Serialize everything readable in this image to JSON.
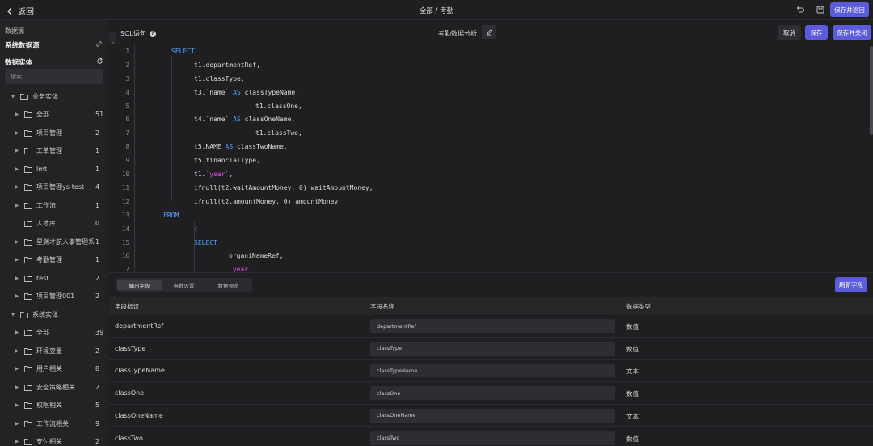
{
  "topbar": {
    "back_label": "返回",
    "title": "全部 / 考勤",
    "save_return_label": "保存并返回"
  },
  "sidebar": {
    "datasource_label": "数据源",
    "datasource_name": "系统数据源",
    "entity_title": "数据实体",
    "search_placeholder": "搜索",
    "business_group": "业务实体",
    "business_items": [
      {
        "label": "全部",
        "count": "51",
        "expandable": true
      },
      {
        "label": "项目管理",
        "count": "2",
        "expandable": true
      },
      {
        "label": "工单管理",
        "count": "1",
        "expandable": true
      },
      {
        "label": "lmt",
        "count": "1",
        "expandable": true
      },
      {
        "label": "项目管理ys-test",
        "count": "4",
        "expandable": true
      },
      {
        "label": "工作流",
        "count": "1",
        "expandable": true
      },
      {
        "label": "人才库",
        "count": "0",
        "expandable": false
      },
      {
        "label": "星渊才航人事管理系统",
        "count": "1",
        "expandable": true
      },
      {
        "label": "考勤管理",
        "count": "1",
        "expandable": true
      },
      {
        "label": "test",
        "count": "2",
        "expandable": true
      },
      {
        "label": "项目管理001",
        "count": "2",
        "expandable": true
      }
    ],
    "system_group": "系统实体",
    "system_items": [
      {
        "label": "全部",
        "count": "39",
        "expandable": true
      },
      {
        "label": "环境变量",
        "count": "2",
        "expandable": true
      },
      {
        "label": "用户相关",
        "count": "8",
        "expandable": true
      },
      {
        "label": "安全策略相关",
        "count": "2",
        "expandable": true
      },
      {
        "label": "权限相关",
        "count": "5",
        "expandable": true
      },
      {
        "label": "工作流相关",
        "count": "9",
        "expandable": true
      },
      {
        "label": "支付相关",
        "count": "2",
        "expandable": true
      }
    ]
  },
  "editor": {
    "sql_label": "SQL语句",
    "query_name": "考勤数据分析",
    "cancel_label": "取消",
    "save_label": "保存",
    "save_close_label": "保存并关闭",
    "lines": [
      {
        "n": "1",
        "segments": [
          {
            "t": "SELECT",
            "c": "kw"
          }
        ],
        "indent": 1
      },
      {
        "n": "2",
        "segments": [
          {
            "t": "t1.departmentRef,",
            "c": ""
          }
        ],
        "indent": 2
      },
      {
        "n": "3",
        "segments": [
          {
            "t": "t1.classType,",
            "c": ""
          }
        ],
        "indent": 2
      },
      {
        "n": "4",
        "segments": [
          {
            "t": "t3.`name` ",
            "c": ""
          },
          {
            "t": "AS",
            "c": "kw"
          },
          {
            "t": " classTypeName,",
            "c": ""
          }
        ],
        "indent": 2
      },
      {
        "n": "5",
        "segments": [
          {
            "t": "t1.classOne,",
            "c": ""
          }
        ],
        "indent": 4
      },
      {
        "n": "6",
        "segments": [
          {
            "t": "t4.`name` ",
            "c": ""
          },
          {
            "t": "AS",
            "c": "kw"
          },
          {
            "t": " classOneName,",
            "c": ""
          }
        ],
        "indent": 2
      },
      {
        "n": "7",
        "segments": [
          {
            "t": "t1.classTwo,",
            "c": ""
          }
        ],
        "indent": 4
      },
      {
        "n": "8",
        "segments": [
          {
            "t": "t5.NAME ",
            "c": ""
          },
          {
            "t": "AS",
            "c": "kw"
          },
          {
            "t": " classTwoName,",
            "c": ""
          }
        ],
        "indent": 2
      },
      {
        "n": "9",
        "segments": [
          {
            "t": "t5.financialType,",
            "c": ""
          }
        ],
        "indent": 2
      },
      {
        "n": "10",
        "segments": [
          {
            "t": "t1.",
            "c": ""
          },
          {
            "t": "`year`",
            "c": "str"
          },
          {
            "t": ",",
            "c": ""
          }
        ],
        "indent": 2
      },
      {
        "n": "11",
        "segments": [
          {
            "t": "ifnull(t2.waitAmountMoney, 0) waitAmountMoney,",
            "c": ""
          }
        ],
        "indent": 2
      },
      {
        "n": "12",
        "segments": [
          {
            "t": "ifnull(t2.amountMoney, 0) amountMoney",
            "c": ""
          }
        ],
        "indent": 2
      },
      {
        "n": "13",
        "segments": [
          {
            "t": "FROM",
            "c": "kw"
          }
        ],
        "indent": 0
      },
      {
        "n": "14",
        "segments": [
          {
            "t": "(",
            "c": ""
          }
        ],
        "indent": 2
      },
      {
        "n": "15",
        "segments": [
          {
            "t": "SELECT",
            "c": "kw"
          }
        ],
        "indent": 2
      },
      {
        "n": "16",
        "segments": [
          {
            "t": "organiNameRef,",
            "c": ""
          }
        ],
        "indent": 3
      },
      {
        "n": "17",
        "segments": [
          {
            "t": "`year`",
            "c": "str"
          }
        ],
        "indent": 3
      }
    ]
  },
  "bottom": {
    "tabs": [
      "输出字段",
      "参数设置",
      "数据预览"
    ],
    "active_tab": 0,
    "refresh_label": "刷新字段",
    "headers": [
      "字段标识",
      "字段名称",
      "数据类型"
    ],
    "rows": [
      {
        "id": "departmentRef",
        "name": "departmentRef",
        "type": "数值"
      },
      {
        "id": "classType",
        "name": "classType",
        "type": "数值"
      },
      {
        "id": "classTypeName",
        "name": "classTypeName",
        "type": "文本"
      },
      {
        "id": "classOne",
        "name": "classOne",
        "type": "数值"
      },
      {
        "id": "classOneName",
        "name": "classOneName",
        "type": "文本"
      },
      {
        "id": "classTwo",
        "name": "classTwo",
        "type": "数值"
      }
    ]
  },
  "colors": {
    "accent": "#5b5bdc",
    "keyword": "#4aa3ff",
    "string": "#e24de6"
  }
}
